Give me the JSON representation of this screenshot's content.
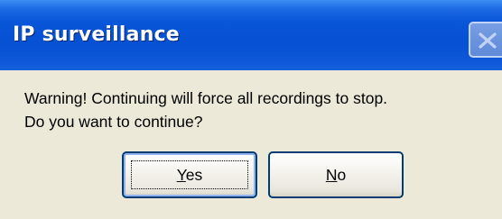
{
  "window": {
    "title": "IP surveillance"
  },
  "titlebar": {
    "close_icon": "close-icon"
  },
  "message": {
    "line1": "Warning!  Continuing will force all recordings to stop.",
    "line2": "Do you want to continue?"
  },
  "buttons": {
    "yes": {
      "accel": "Y",
      "rest": "es"
    },
    "no": {
      "accel": "N",
      "rest": "o"
    }
  },
  "colors": {
    "titlebar": "#0651d4",
    "dialog_bg": "#ece9d8",
    "button_border": "#003c74"
  }
}
